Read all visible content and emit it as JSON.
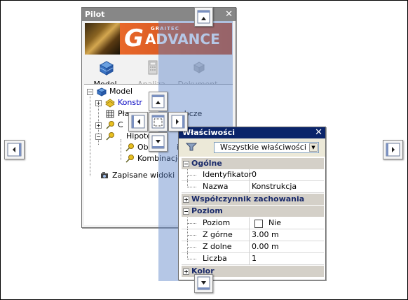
{
  "pilot": {
    "title": "Pilot",
    "close_label": "✕",
    "banner": {
      "small": "GRAITEC",
      "big_g": "G",
      "advance": "ADVANCE"
    },
    "tools": [
      {
        "label": "Model",
        "enabled": true,
        "icon": "model-icon"
      },
      {
        "label": "Analiza",
        "enabled": false,
        "icon": "calculator-icon"
      },
      {
        "label": "Dokument",
        "enabled": false,
        "icon": "document-icon"
      }
    ],
    "tree": {
      "root": "Model",
      "items": [
        "Konstrukcja",
        "Płaszczyzny obciążenia",
        "Obciążenia",
        "Hipoteza",
        "Obciążenie",
        "Kombinacje"
      ],
      "saved_views": "Zapisane widoki",
      "visible_fragments": {
        "konstr": "Konstr",
        "plasz": "Płaszcz",
        "plasz_end": "obcze",
        "hipote": "Hipote",
        "ob": "Ob",
        "ob_end": "ie",
        "kombinacje": "Kombinacje",
        "c": "C"
      }
    }
  },
  "properties": {
    "title": "Właściwości",
    "filter": "Wszystkie właściwości",
    "categories": [
      {
        "name": "Ogólne",
        "expanded": true,
        "rows": [
          {
            "name": "Identyfikator",
            "value": "0"
          },
          {
            "name": "Nazwa",
            "value": "Konstrukcja"
          }
        ]
      },
      {
        "name": "Współczynnik zachowania",
        "expanded": false,
        "rows": []
      },
      {
        "name": "Poziom",
        "expanded": true,
        "rows": [
          {
            "name": "Poziom",
            "value": "Nie",
            "checkbox": true
          },
          {
            "name": "Z górne",
            "value": "3.00 m"
          },
          {
            "name": "Z dolne",
            "value": "0.00 m"
          },
          {
            "name": "Liczba",
            "value": "1"
          }
        ]
      },
      {
        "name": "Kolor",
        "expanded": false,
        "rows": []
      }
    ]
  },
  "colors": {
    "titlebar_inactive": "#878787",
    "titlebar_active": "#0a246a",
    "dock_shade": "#5a82c8",
    "banner_orange": "#e8682a"
  },
  "dock_guides": [
    "dock-top",
    "dock-bottom",
    "dock-left",
    "dock-right",
    "dock-center-top",
    "dock-center-left",
    "dock-center-fill",
    "dock-center-right",
    "dock-center-bottom"
  ]
}
